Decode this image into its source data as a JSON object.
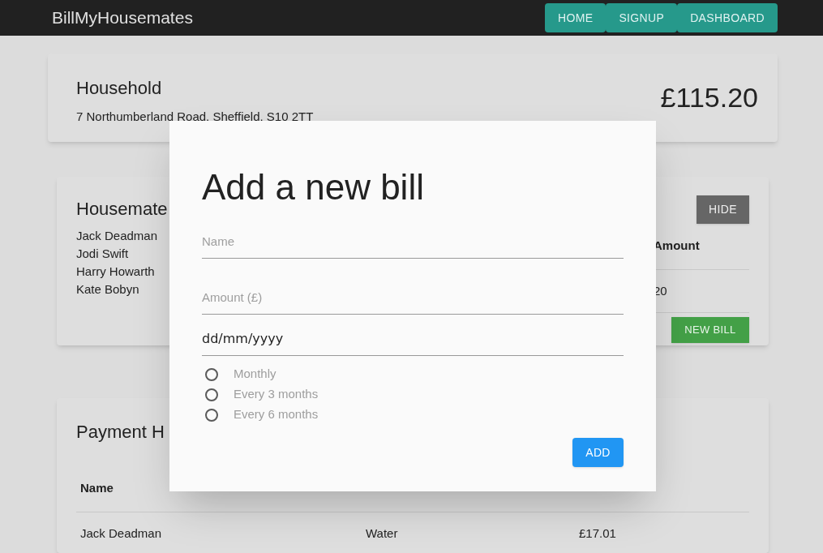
{
  "navbar": {
    "brand": "BillMyHousemates",
    "links": [
      {
        "label": "HOME"
      },
      {
        "label": "SIGNUP"
      },
      {
        "label": "DASHBOARD"
      }
    ]
  },
  "household": {
    "title": "Household",
    "address": "7 Northumberland Road, Sheffield, S10 2TT",
    "total": "£115.20"
  },
  "housemates": {
    "title": "Housemate",
    "members": [
      "Jack Deadman",
      "Jodi Swift",
      "Harry Howarth",
      "Kate Bobyn"
    ],
    "hide_button": "HIDE",
    "column": "Amount",
    "cell": "20",
    "new_bill_button": "NEW BILL"
  },
  "payment_history": {
    "title": "Payment H",
    "columns": [
      "Name"
    ],
    "rows": [
      [
        "Jack Deadman",
        "Water",
        "£17.01"
      ]
    ]
  },
  "dialog": {
    "title": "Add a new bill",
    "fields": [
      {
        "placeholder": "Name"
      },
      {
        "placeholder": "Amount (£)"
      }
    ],
    "date_field": {
      "value": "dd/mm/yyyy"
    },
    "frequency": [
      {
        "label": "Monthly",
        "selected": false
      },
      {
        "label": "Every 3 months",
        "selected": false
      },
      {
        "label": "Every 6 months",
        "selected": false
      }
    ],
    "add_button": "ADD"
  }
}
